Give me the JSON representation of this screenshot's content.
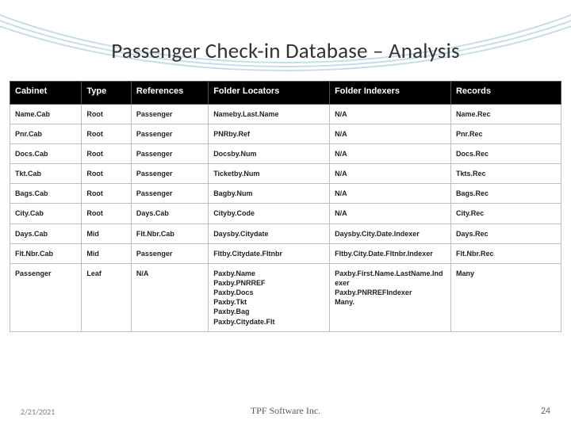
{
  "title": "Passenger Check-in Database – Analysis",
  "footer": {
    "date": "2/21/2021",
    "org": "TPF Software Inc.",
    "page": "24"
  },
  "table": {
    "headers": [
      "Cabinet",
      "Type",
      "References",
      "Folder Locators",
      "Folder Indexers",
      "Records"
    ],
    "rows": [
      {
        "cabinet": "Name.Cab",
        "type": "Root",
        "references": "Passenger",
        "locators": [
          "Nameby.Last.Name"
        ],
        "indexers": [
          "N/A"
        ],
        "records": "Name.Rec"
      },
      {
        "cabinet": "Pnr.Cab",
        "type": "Root",
        "references": "Passenger",
        "locators": [
          "PNRby.Ref"
        ],
        "indexers": [
          "N/A"
        ],
        "records": "Pnr.Rec"
      },
      {
        "cabinet": "Docs.Cab",
        "type": "Root",
        "references": "Passenger",
        "locators": [
          "Docsby.Num"
        ],
        "indexers": [
          "N/A"
        ],
        "records": "Docs.Rec"
      },
      {
        "cabinet": "Tkt.Cab",
        "type": "Root",
        "references": "Passenger",
        "locators": [
          "Ticketby.Num"
        ],
        "indexers": [
          "N/A"
        ],
        "records": "Tkts.Rec"
      },
      {
        "cabinet": "Bags.Cab",
        "type": "Root",
        "references": "Passenger",
        "locators": [
          "Bagby.Num"
        ],
        "indexers": [
          "N/A"
        ],
        "records": "Bags.Rec"
      },
      {
        "cabinet": "City.Cab",
        "type": "Root",
        "references": "Days.Cab",
        "locators": [
          "Cityby.Code"
        ],
        "indexers": [
          "N/A"
        ],
        "records": "City.Rec"
      },
      {
        "cabinet": "Days.Cab",
        "type": "Mid",
        "references": "Flt.Nbr.Cab",
        "locators": [
          "Daysby.Citydate"
        ],
        "indexers": [
          "Daysby.City.Date.Indexer"
        ],
        "records": "Days.Rec"
      },
      {
        "cabinet": "Flt.Nbr.Cab",
        "type": "Mid",
        "references": "Passenger",
        "locators": [
          "Fltby.Citydate.Fltnbr"
        ],
        "indexers": [
          "Fltby.City.Date.Fltnbr.Indexer"
        ],
        "records": "Flt.Nbr.Rec"
      },
      {
        "cabinet": "Passenger",
        "type": "Leaf",
        "references": "N/A",
        "locators": [
          "Paxby.Name",
          "Paxby.PNRREF",
          "Paxby.Docs",
          "Paxby.Tkt",
          "Paxby.Bag",
          "Paxby.Citydate.Flt"
        ],
        "indexers": [
          "Paxby.First.Name.LastName.Indexer",
          "Paxby.PNRREFIndexer",
          "Many."
        ],
        "records": "Many"
      }
    ]
  }
}
